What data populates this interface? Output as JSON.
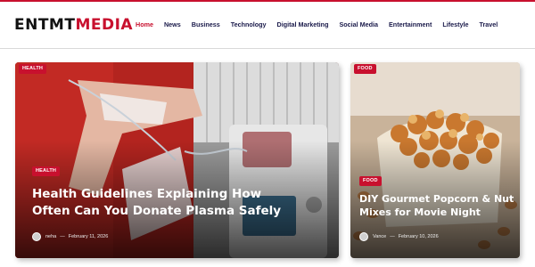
{
  "brand": {
    "part1": "ENTMT",
    "part2": "MEDIA",
    "accent": "#c8102e"
  },
  "nav": {
    "items": [
      "Home",
      "News",
      "Business",
      "Technology",
      "Digital Marketing",
      "Social Media",
      "Entertainment",
      "Lifestyle",
      "Travel"
    ],
    "active": "Home"
  },
  "posts": [
    {
      "category": "HEALTH",
      "title": "Health Guidelines Explaining How Often Can You Donate Plasma Safely",
      "author": "neha",
      "date": "February 11, 2026"
    },
    {
      "category": "FOOD",
      "title": "DIY Gourmet Popcorn & Nut Mixes for Movie Night",
      "author": "Vance",
      "date": "February 10, 2026"
    }
  ]
}
